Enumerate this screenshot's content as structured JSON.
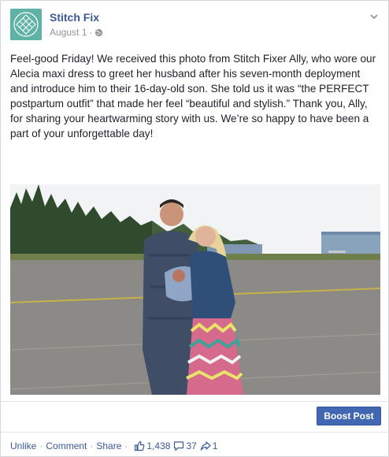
{
  "post": {
    "page_name": "Stitch Fix",
    "date": "August 1",
    "meta_separator": "·",
    "text": "Feel-good Friday! We received this photo from Stitch Fixer Ally, who wore our Alecia maxi dress to greet her husband after his seven-month deployment and introduce him to their 16-day-old son. She told us it was “the PERFECT postpartum outfit” that made her feel “beautiful and stylish.” Thank you, Ally, for sharing your heartwarming story with us. We’re so happy to have been a part of your unforgettable day!",
    "boost_label": "Boost Post"
  },
  "actions": {
    "unlike": "Unlike",
    "comment": "Comment",
    "share": "Share",
    "separator": "·",
    "likes": "1,438",
    "comments": "37",
    "shares": "1"
  },
  "colors": {
    "link": "#3b5998",
    "button": "#4267b2",
    "avatar": "#5fb3a4"
  },
  "icons": {
    "avatar": "stitch-fix-logo",
    "audience": "globe-icon",
    "menu": "chevron-down-icon",
    "like": "thumbs-up-icon",
    "comment": "comment-icon",
    "share": "share-icon"
  }
}
